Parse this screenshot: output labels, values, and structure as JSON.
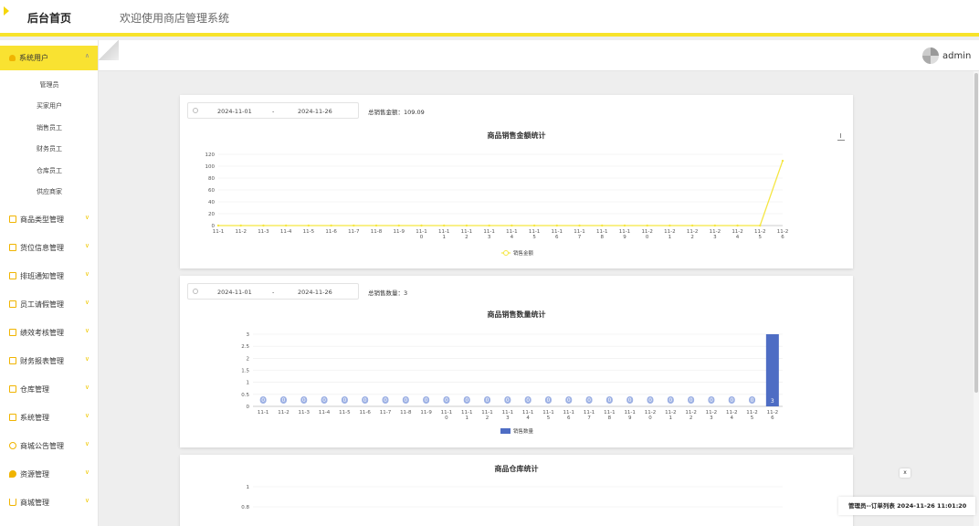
{
  "header": {
    "brand": "后台首页",
    "welcome": "欢迎使用商店管理系统",
    "accent": "#f7e32a"
  },
  "user": {
    "name": "admin"
  },
  "sidebar": {
    "active": {
      "label": "系统用户",
      "icon": "user-icon"
    },
    "subitems": [
      "管理员",
      "买家用户",
      "销售员工",
      "财务员工",
      "仓库员工",
      "供应商家"
    ],
    "items": [
      {
        "label": "商品类型管理",
        "icon": "doc-icon"
      },
      {
        "label": "货位信息管理",
        "icon": "doc-icon"
      },
      {
        "label": "排班通知管理",
        "icon": "doc-icon"
      },
      {
        "label": "员工请假管理",
        "icon": "doc-icon"
      },
      {
        "label": "绩效考核管理",
        "icon": "doc-icon"
      },
      {
        "label": "财务报表管理",
        "icon": "doc-icon"
      },
      {
        "label": "仓库管理",
        "icon": "doc-icon"
      },
      {
        "label": "系统管理",
        "icon": "doc-icon"
      },
      {
        "label": "商城公告管理",
        "icon": "info-icon"
      },
      {
        "label": "资源管理",
        "icon": "pin-icon"
      },
      {
        "label": "商城管理",
        "icon": "cart-icon"
      }
    ]
  },
  "panel1": {
    "start": "2024-11-01",
    "sep": "-",
    "end": "2024-11-26",
    "total": "总销售金额：109.09"
  },
  "panel2": {
    "start": "2024-11-01",
    "sep": "-",
    "end": "2024-11-26",
    "total": "总销售数量：3"
  },
  "notification": {
    "text": "管理员--订单列表 2024-11-26 11:01:20",
    "close": "x"
  },
  "chart_data": [
    {
      "type": "line",
      "title": "商品销售金额统计",
      "categories": [
        "11-1",
        "11-2",
        "11-3",
        "11-4",
        "11-5",
        "11-6",
        "11-7",
        "11-8",
        "11-9",
        "11-10",
        "11-11",
        "11-12",
        "11-13",
        "11-14",
        "11-15",
        "11-16",
        "11-17",
        "11-18",
        "11-19",
        "11-20",
        "11-21",
        "11-22",
        "11-23",
        "11-24",
        "11-25",
        "11-26"
      ],
      "series": [
        {
          "name": "销售金额",
          "values": [
            0,
            0,
            0,
            0,
            0,
            0,
            0,
            0,
            0,
            0,
            0,
            0,
            0,
            0,
            0,
            0,
            0,
            0,
            0,
            0,
            0,
            0,
            0,
            0,
            0,
            109.09
          ]
        }
      ],
      "ylim": [
        0,
        120
      ],
      "yticks": [
        0,
        20,
        40,
        60,
        80,
        100,
        120
      ],
      "color": "#f5e642",
      "legend": "bottom",
      "grid": true
    },
    {
      "type": "bar",
      "title": "商品销售数量统计",
      "categories": [
        "11-1",
        "11-2",
        "11-3",
        "11-4",
        "11-5",
        "11-6",
        "11-7",
        "11-8",
        "11-9",
        "11-10",
        "11-11",
        "11-12",
        "11-13",
        "11-14",
        "11-15",
        "11-16",
        "11-17",
        "11-18",
        "11-19",
        "11-20",
        "11-21",
        "11-22",
        "11-23",
        "11-24",
        "11-25",
        "11-26"
      ],
      "series": [
        {
          "name": "销售数量",
          "values": [
            0,
            0,
            0,
            0,
            0,
            0,
            0,
            0,
            0,
            0,
            0,
            0,
            0,
            0,
            0,
            0,
            0,
            0,
            0,
            0,
            0,
            0,
            0,
            0,
            0,
            3
          ]
        }
      ],
      "ylim": [
        0,
        3
      ],
      "yticks": [
        "0",
        "0.5",
        "1",
        "1.5",
        "2",
        "2.5",
        "3"
      ],
      "color": "#4e6dc4",
      "legend": "bottom",
      "grid": true
    },
    {
      "type": "bar",
      "title": "商品仓库统计",
      "ylim": [
        0,
        1
      ],
      "yticks": [
        "0.8",
        "1"
      ],
      "grid": true
    }
  ]
}
